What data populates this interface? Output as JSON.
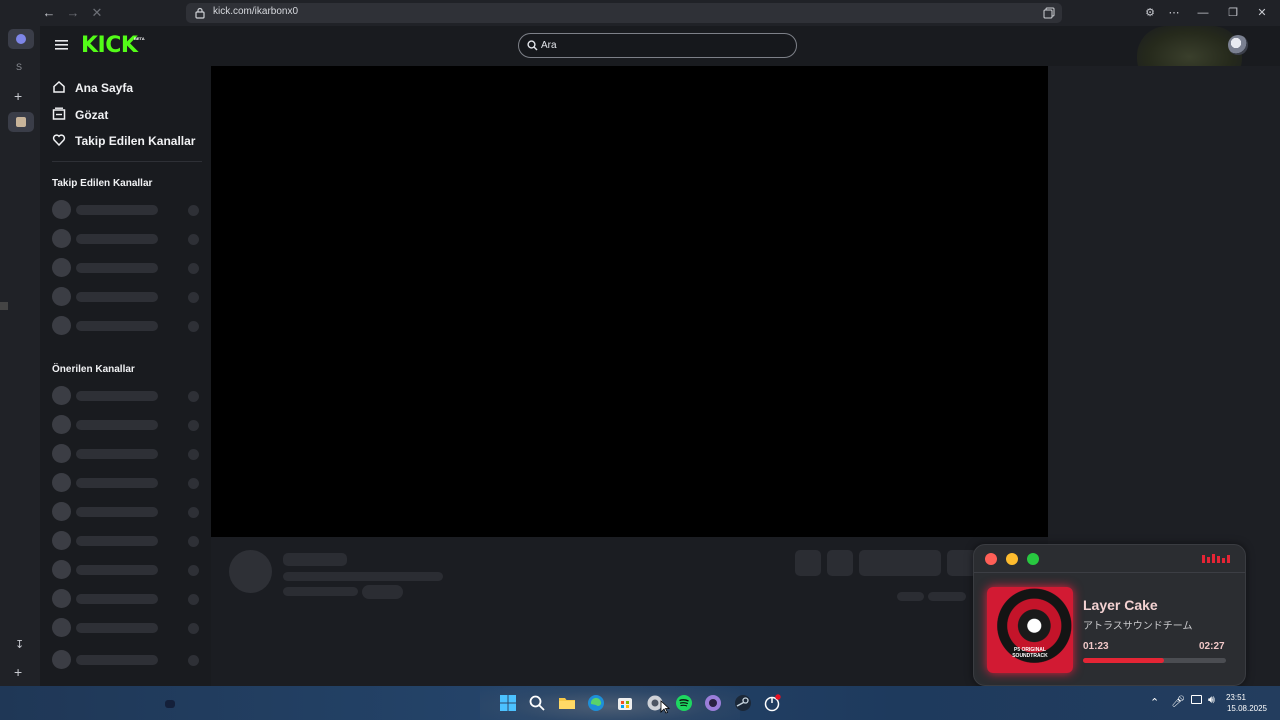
{
  "browser": {
    "url": "kick.com/ikarbonx0",
    "rail_letter": "S"
  },
  "site": {
    "logo_text": "KICK",
    "logo_badge": "BETA",
    "search_placeholder": "Ara"
  },
  "sidebar": {
    "nav": [
      {
        "label": "Ana Sayfa",
        "icon": "home-icon"
      },
      {
        "label": "Gözat",
        "icon": "browse-icon"
      },
      {
        "label": "Takip Edilen Kanallar",
        "icon": "heart-icon"
      }
    ],
    "followed_title": "Takip Edilen Kanallar",
    "recommended_title": "Önerilen Kanallar"
  },
  "player_widget": {
    "title": "Layer Cake",
    "artist": "アトラスサウンドチーム",
    "elapsed": "01:23",
    "duration": "02:27",
    "progress_fraction": 0.565,
    "cover_text": "P5 ORIGINAL SOUNDTRACK"
  },
  "taskbar": {
    "time": "23:51",
    "date": "15.08.2025"
  },
  "colors": {
    "kick_green": "#53fc18",
    "widget_red": "#e52535",
    "dot_red": "#ff5f57",
    "dot_yellow": "#febc2e",
    "dot_green": "#28c840"
  }
}
